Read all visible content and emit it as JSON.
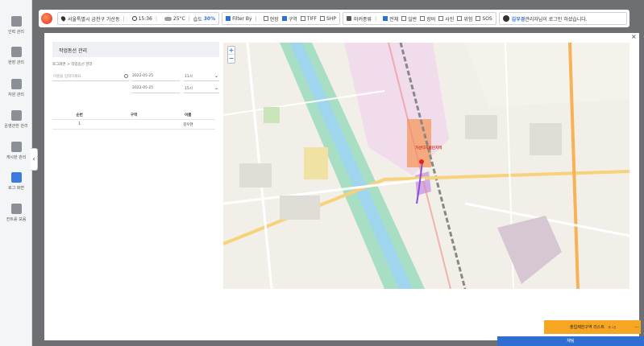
{
  "sidebar": {
    "items": [
      {
        "label": "인력 관리",
        "icon": "person-badge-icon"
      },
      {
        "label": "현장 관리",
        "icon": "map-flag-icon"
      },
      {
        "label": "자원 관리",
        "icon": "resource-icon"
      },
      {
        "label": "운영관한 관리",
        "icon": "operator-icon"
      },
      {
        "label": "게시판 관리",
        "icon": "board-icon"
      },
      {
        "label": "로그 화면",
        "icon": "log-screen-icon"
      },
      {
        "label": "컨트롤 모음",
        "icon": "control-icon"
      }
    ],
    "collapse_glyph": "‹"
  },
  "topbar": {
    "location": "서울특별시 금천구 가산동",
    "time": "15:36",
    "temperature": "25°C",
    "humidity_label": "습도",
    "humidity_value": "30%",
    "filter_label": "Filter By",
    "filters": [
      {
        "label": "현장",
        "checked": false
      },
      {
        "label": "구역",
        "checked": true
      },
      {
        "label": "TIFF",
        "checked": false
      },
      {
        "label": "SHP",
        "checked": false
      }
    ],
    "marker_label": "마커종류",
    "markers": [
      {
        "label": "전체",
        "checked": true
      },
      {
        "label": "일반",
        "checked": false
      },
      {
        "label": "장비",
        "checked": false
      },
      {
        "label": "사진",
        "checked": false
      },
      {
        "label": "위험",
        "checked": false
      },
      {
        "label": "SOS",
        "checked": false
      }
    ],
    "user_name": "김우경",
    "user_message": " 관리자님이 로그인 하셨습니다."
  },
  "panel": {
    "title": "작업동선 관리",
    "breadcrumb_home": "로그화면",
    "breadcrumb_sep": ">",
    "breadcrumb_current": "작업동선 관리",
    "search_placeholder": "이름을 입력하세요.",
    "start_date": "2022-05-25",
    "start_hour": "11시",
    "end_date": "2022-05-25",
    "end_hour": "15시",
    "table": {
      "headers": [
        "순번",
        "구역",
        "이름"
      ],
      "rows": [
        [
          "1",
          "",
          "김우현"
        ]
      ]
    }
  },
  "map": {
    "zoom_in": "+",
    "zoom_out": "−",
    "station_label": "가산디지털단지역"
  },
  "restrict_bar": {
    "title": "출입제한구역 리스트",
    "count": "총 1건",
    "more": "..."
  },
  "bottom_button": "채팅",
  "close_glyph": "×"
}
